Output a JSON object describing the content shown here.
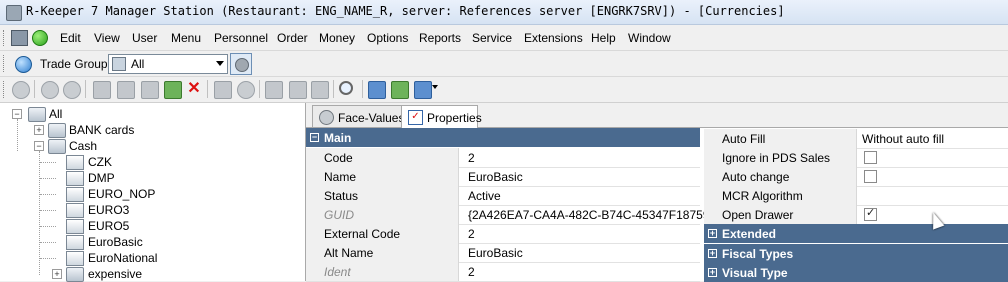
{
  "window": {
    "title": "R-Keeper 7 Manager Station (Restaurant: ENG_NAME_R, server: References server [ENGRK7SRV]) - [Currencies]"
  },
  "menu": {
    "items": [
      "Edit",
      "View",
      "User",
      "Menu",
      "Personnel",
      "Order",
      "Money",
      "Options",
      "Reports",
      "Service",
      "Extensions",
      "Help",
      "Window"
    ]
  },
  "toolbar": {
    "trade_group_label": "Trade Group:",
    "trade_group_value": "All"
  },
  "tree": {
    "root": "All",
    "bank": "BANK cards",
    "cash": "Cash",
    "items": [
      "CZK",
      "DMP",
      "EURO_NOP",
      "EURO3",
      "EURO5",
      "EuroBasic",
      "EuroNational"
    ],
    "expensive": "expensive"
  },
  "tabs": {
    "face_values": "Face-Values",
    "properties": "Properties"
  },
  "props_left": {
    "category": "Main",
    "rows": [
      {
        "name": "Code",
        "value": "2"
      },
      {
        "name": "Name",
        "value": "EuroBasic"
      },
      {
        "name": "Status",
        "value": "Active"
      },
      {
        "name": "GUID",
        "value": "{2A426EA7-CA4A-482C-B74C-45347F18759F}"
      },
      {
        "name": "External Code",
        "value": "2"
      },
      {
        "name": "Alt Name",
        "value": "EuroBasic"
      },
      {
        "name": "Ident",
        "value": "2"
      }
    ]
  },
  "props_right": {
    "rows": [
      {
        "name": "Auto Fill",
        "value": "Without auto fill"
      },
      {
        "name": "Ignore in PDS Sales",
        "value": ""
      },
      {
        "name": "Auto change",
        "value": ""
      },
      {
        "name": "MCR Algorithm",
        "value": ""
      },
      {
        "name": "Open Drawer",
        "value": ""
      }
    ],
    "categories": [
      "Extended",
      "Fiscal Types",
      "Visual Type"
    ]
  },
  "colors": {
    "category_bg": "#4a6a8f",
    "title_bg": "#dce8f6"
  }
}
